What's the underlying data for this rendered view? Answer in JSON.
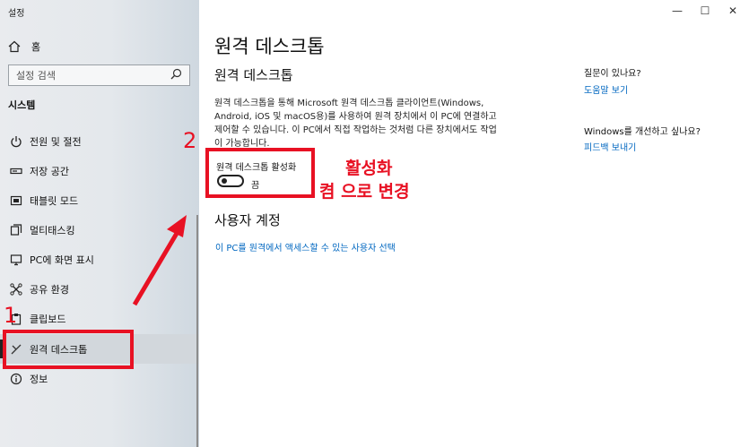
{
  "window": {
    "title": "설정",
    "controls": [
      "—",
      "☐",
      "✕"
    ]
  },
  "sidebar": {
    "home_label": "홈",
    "search_placeholder": "설정 검색",
    "section": "시스템",
    "items": [
      {
        "label": "전원 및 절전",
        "icon": "power-icon"
      },
      {
        "label": "저장 공간",
        "icon": "storage-icon"
      },
      {
        "label": "태블릿 모드",
        "icon": "tablet-icon"
      },
      {
        "label": "멀티태스킹",
        "icon": "multitasking-icon"
      },
      {
        "label": "PC에 화면 표시",
        "icon": "project-icon"
      },
      {
        "label": "공유 환경",
        "icon": "shared-icon"
      },
      {
        "label": "클립보드",
        "icon": "clipboard-icon"
      },
      {
        "label": "원격 데스크톱",
        "icon": "remote-desktop-icon",
        "selected": true
      },
      {
        "label": "정보",
        "icon": "info-icon"
      }
    ]
  },
  "main": {
    "title": "원격 데스크톱",
    "section_title": "원격 데스크톱",
    "description": "원격 데스크톱을 통해 Microsoft 원격 데스크톱 클라이언트(Windows, Android, iOS 및 macOS용)를 사용하여 원격 장치에서 이 PC에 연결하고 제어할 수 있습니다. 이 PC에서 직접 작업하는 것처럼 다른 장치에서도 작업이 가능합니다.",
    "toggle_label": "원격 데스크톱 활성화",
    "toggle_state": "끔",
    "toggle_on": false,
    "user_accounts_title": "사용자 계정",
    "user_accounts_link": "이 PC를 원격에서 액세스할 수 있는 사용자 선택"
  },
  "right_panel": {
    "question": "질문이 있나요?",
    "help_link": "도움말 보기",
    "improve": "Windows를 개선하고 싶나요?",
    "feedback_link": "피드백 보내기"
  },
  "annotations": {
    "step1": "1",
    "step2": "2",
    "note_line1": "활성화",
    "note_line2": "켬 으로 변경",
    "accent": "#e81123"
  }
}
